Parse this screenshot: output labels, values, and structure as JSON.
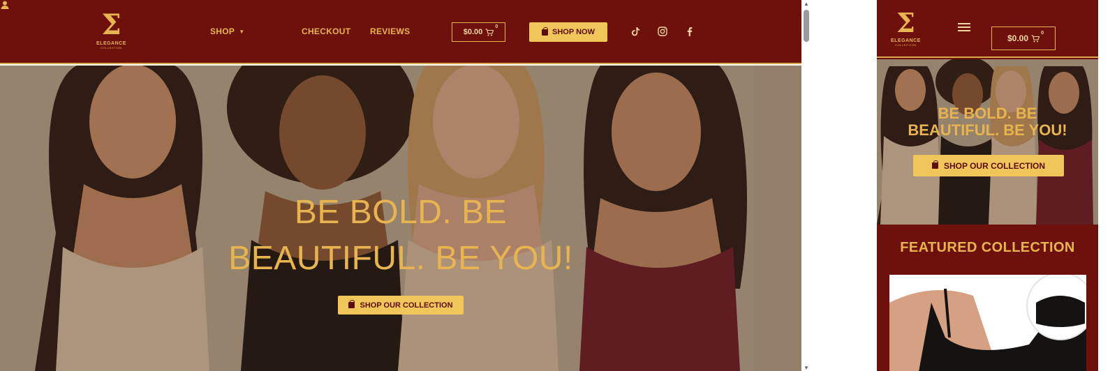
{
  "brand": {
    "mark": "Σ",
    "name": "ELEGANCE",
    "sub": "COLLECTION"
  },
  "nav": {
    "shop": "SHOP",
    "checkout": "CHECKOUT",
    "reviews": "REVIEWS",
    "user_icon": "user-icon"
  },
  "cart": {
    "amount": "$0.00",
    "count": "0"
  },
  "cta": {
    "shop_now": "SHOP NOW",
    "shop_collection": "SHOP OUR COLLECTION"
  },
  "hero": {
    "line1": "BE BOLD. BE",
    "line2": "BEAUTIFUL. BE YOU!",
    "mobile_line1": "BE BOLD. BE",
    "mobile_line2": "BEAUTIFUL. BE YOU!"
  },
  "social": [
    "tiktok-icon",
    "instagram-icon",
    "facebook-icon"
  ],
  "featured": {
    "title": "FEATURED COLLECTION"
  },
  "colors": {
    "header_bg": "#6e110d",
    "accent_gold": "#e8b44f",
    "button_gold": "#f0c55a"
  }
}
